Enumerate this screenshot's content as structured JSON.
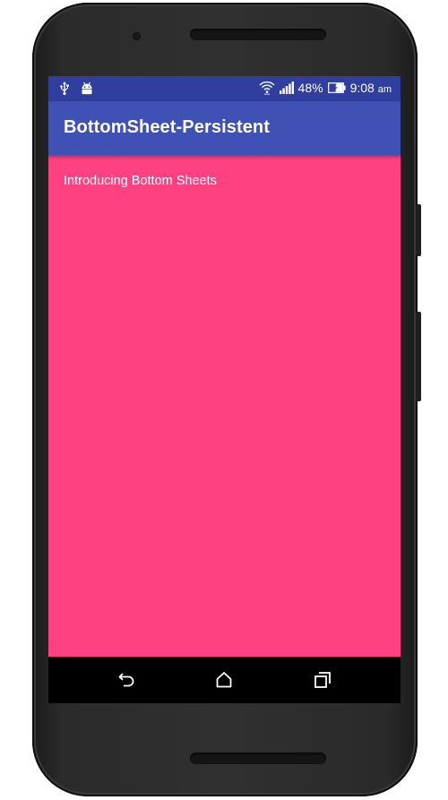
{
  "status_bar": {
    "battery_percent": "48%",
    "time": "9:08",
    "ampm": "am",
    "icons_left": [
      "usb-icon",
      "android-debug-icon"
    ],
    "icons_right": [
      "wifi-icon",
      "cellular-signal-icon",
      "battery-charging-icon"
    ]
  },
  "app_bar": {
    "title": "BottomSheet-Persistent"
  },
  "content": {
    "text": "Introducing Bottom Sheets"
  },
  "nav_bar": {
    "buttons": [
      "back-icon",
      "home-icon",
      "recents-icon"
    ]
  },
  "colors": {
    "status_bar": "#303F9F",
    "app_bar": "#3F51B5",
    "content_background": "#FF4081",
    "nav_bar": "#000000"
  }
}
